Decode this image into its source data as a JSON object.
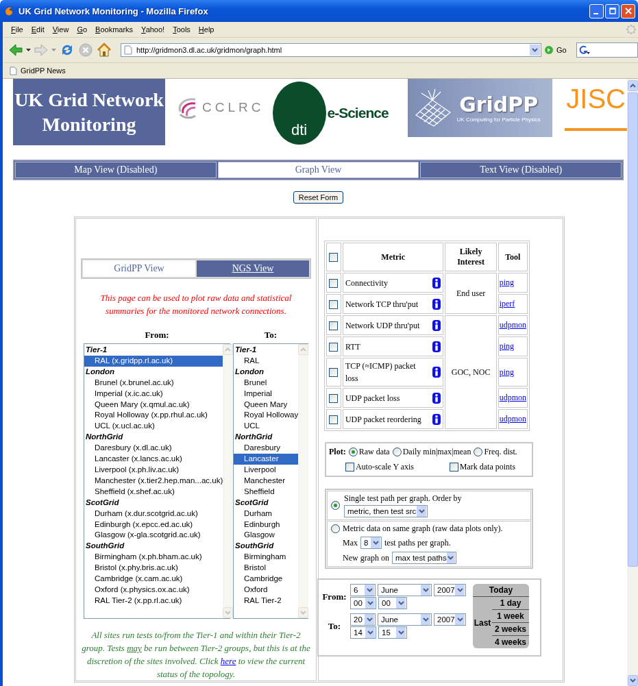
{
  "window": {
    "title": "UK Grid Network Monitoring - Mozilla Firefox"
  },
  "menu": [
    "File",
    "Edit",
    "View",
    "Go",
    "Bookmarks",
    "Yahoo!",
    "Tools",
    "Help"
  ],
  "address": {
    "value": "http://gridmon3.dl.ac.uk/gridmon/graph.html"
  },
  "go_button": "Go",
  "bookmarks": [
    "GridPP News"
  ],
  "banner": {
    "title": "UK Grid Network Monitoring",
    "logos": [
      {
        "kind": "cclrc",
        "text": "CCLRC"
      },
      {
        "kind": "escience",
        "text": "e-Science",
        "subtext": "dti"
      },
      {
        "kind": "gridpp",
        "text": "GridPP",
        "subtext": "UK Computing for Particle Physics"
      },
      {
        "kind": "jisc",
        "text": "JISC"
      }
    ]
  },
  "view_tabs": [
    {
      "label": "Map View (Disabled)",
      "selected": false
    },
    {
      "label": "Graph View",
      "selected": true
    },
    {
      "label": "Text View (Disabled)",
      "selected": false
    }
  ],
  "reset_button": "Reset Form",
  "site_tabs": [
    {
      "label": "GridPP View",
      "selected": true
    },
    {
      "label": "NGS View",
      "selected": false
    }
  ],
  "intro": "This page can be used to plot raw data and statistical summaries for the monitored network connections.",
  "from": {
    "label": "From:",
    "groups": [
      {
        "label": "Tier-1",
        "children": [
          {
            "label": "RAL (x.gridpp.rl.ac.uk)",
            "selected": true
          }
        ]
      },
      {
        "label": "London",
        "children": [
          {
            "label": "Brunel (x.brunel.ac.uk)",
            "selected": false
          },
          {
            "label": "Imperial (x.ic.ac.uk)",
            "selected": false
          },
          {
            "label": "Queen Mary (x.qmul.ac.uk)",
            "selected": false
          },
          {
            "label": "Royal Holloway (x.pp.rhul.ac.uk)",
            "selected": false
          },
          {
            "label": "UCL (x.ucl.ac.uk)",
            "selected": false
          }
        ]
      },
      {
        "label": "NorthGrid",
        "children": [
          {
            "label": "Daresbury (x.dl.ac.uk)",
            "selected": false
          },
          {
            "label": "Lancaster (x.lancs.ac.uk)",
            "selected": false
          },
          {
            "label": "Liverpool (x.ph.liv.ac.uk)",
            "selected": false
          },
          {
            "label": "Manchester (x.tier2.hep.man...ac.uk)",
            "selected": false
          },
          {
            "label": "Sheffield (x.shef.ac.uk)",
            "selected": false
          }
        ]
      },
      {
        "label": "ScotGrid",
        "children": [
          {
            "label": "Durham (x.dur.scotgrid.ac.uk)",
            "selected": false
          },
          {
            "label": "Edinburgh (x.epcc.ed.ac.uk)",
            "selected": false
          },
          {
            "label": "Glasgow (x-gla.scotgrid.ac.uk)",
            "selected": false
          }
        ]
      },
      {
        "label": "SouthGrid",
        "children": [
          {
            "label": "Birmingham (x.ph.bham.ac.uk)",
            "selected": false
          },
          {
            "label": "Bristol (x.phy.bris.ac.uk)",
            "selected": false
          },
          {
            "label": "Cambridge (x.cam.ac.uk)",
            "selected": false
          },
          {
            "label": "Oxford (x.physics.ox.ac.uk)",
            "selected": false
          },
          {
            "label": "RAL Tier-2 (x.pp.rl.ac.uk)",
            "selected": false
          }
        ]
      }
    ]
  },
  "to": {
    "label": "To:",
    "groups": [
      {
        "label": "Tier-1",
        "children": [
          {
            "label": "RAL",
            "selected": false
          }
        ]
      },
      {
        "label": "London",
        "children": [
          {
            "label": "Brunel",
            "selected": false
          },
          {
            "label": "Imperial",
            "selected": false
          },
          {
            "label": "Queen Mary",
            "selected": false
          },
          {
            "label": "Royal Holloway",
            "selected": false
          },
          {
            "label": "UCL",
            "selected": false
          }
        ]
      },
      {
        "label": "NorthGrid",
        "children": [
          {
            "label": "Daresbury",
            "selected": false
          },
          {
            "label": "Lancaster",
            "selected": true
          },
          {
            "label": "Liverpool",
            "selected": false
          },
          {
            "label": "Manchester",
            "selected": false
          },
          {
            "label": "Sheffield",
            "selected": false
          }
        ]
      },
      {
        "label": "ScotGrid",
        "children": [
          {
            "label": "Durham",
            "selected": false
          },
          {
            "label": "Edinburgh",
            "selected": false
          },
          {
            "label": "Glasgow",
            "selected": false
          }
        ]
      },
      {
        "label": "SouthGrid",
        "children": [
          {
            "label": "Birmingham",
            "selected": false
          },
          {
            "label": "Bristol",
            "selected": false
          },
          {
            "label": "Cambridge",
            "selected": false
          },
          {
            "label": "Oxford",
            "selected": false
          },
          {
            "label": "RAL Tier-2",
            "selected": false
          }
        ]
      }
    ]
  },
  "note": [
    {
      "kind": "text",
      "text": "All sites run tests to/from the Tier-1 and within their Tier-2 group. Tests "
    },
    {
      "kind": "underline",
      "text": "may"
    },
    {
      "kind": "text",
      "text": " be run between Tier-2 groups, but this is at the discretion of the sites involved. Click "
    },
    {
      "kind": "link",
      "text": "here"
    },
    {
      "kind": "text",
      "text": " to view the current status of the topology."
    }
  ],
  "metrics": {
    "all_checked": false,
    "columns": [
      "Metric",
      "Likely Interest",
      "Tool"
    ],
    "rows": [
      {
        "metric": "Connectivity",
        "checked": false,
        "interest": "End user",
        "tool": "ping"
      },
      {
        "metric": "Network TCP thru'put",
        "checked": false,
        "tool": "iperf"
      },
      {
        "metric": "Network UDP thru'put",
        "checked": false,
        "interest": "GOC, NOC",
        "tool": "udpmon"
      },
      {
        "metric": "RTT",
        "checked": false,
        "tool": "ping"
      },
      {
        "metric": "TCP (≈ICMP) packet loss",
        "checked": false,
        "tool": "ping"
      },
      {
        "metric": "UDP packet loss",
        "checked": false,
        "tool": "udpmon"
      },
      {
        "metric": "UDP packet reordering",
        "checked": false,
        "tool": "udpmon"
      }
    ]
  },
  "plot": {
    "label": "Plot:",
    "options": [
      {
        "label": "Raw data",
        "selected": true
      },
      {
        "label": "Daily min|max|mean",
        "selected": false
      },
      {
        "label": "Freq. dist.",
        "selected": false
      }
    ],
    "checkboxes": [
      {
        "label": "Auto-scale Y axis",
        "checked": false
      },
      {
        "label": "Mark data points",
        "checked": false
      }
    ]
  },
  "grouping": [
    {
      "kind": "single",
      "selected": true,
      "label": "Single test path per graph. Order by",
      "order": "metric, then test src"
    },
    {
      "kind": "combined",
      "selected": false,
      "label": "Metric data on same graph (raw data plots only).",
      "max_label": "Max",
      "max": "8",
      "max_suffix": "test paths per graph.",
      "new_label": "New graph on",
      "new_value": "max test paths"
    }
  ],
  "dates": [
    {
      "label": "From:",
      "day": "6",
      "month": "June",
      "year": "2007",
      "hour": "00",
      "minute": "00"
    },
    {
      "label": "To:",
      "day": "20",
      "month": "June",
      "year": "2007",
      "hour": "14",
      "minute": "15"
    }
  ],
  "quick": {
    "today": "Today",
    "last": "Last",
    "options": [
      "1 day",
      "1 week",
      "2 weeks",
      "4 weeks"
    ]
  }
}
